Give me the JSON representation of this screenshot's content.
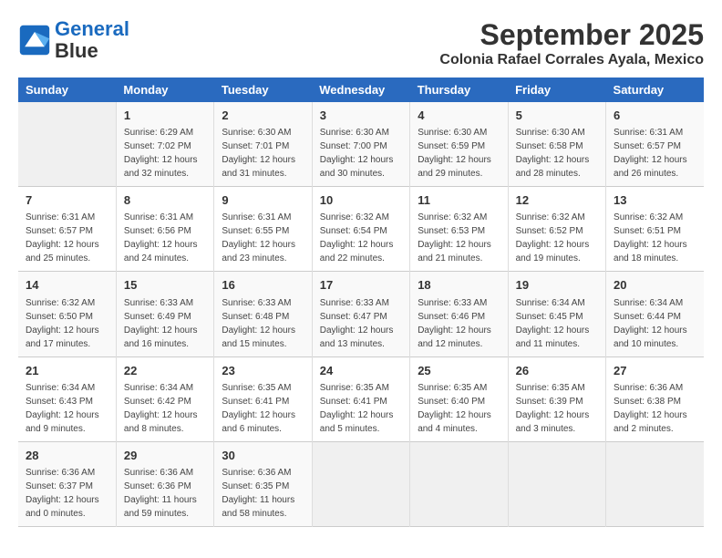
{
  "header": {
    "logo_line1": "General",
    "logo_line2": "Blue",
    "month": "September 2025",
    "location": "Colonia Rafael Corrales Ayala, Mexico"
  },
  "weekdays": [
    "Sunday",
    "Monday",
    "Tuesday",
    "Wednesday",
    "Thursday",
    "Friday",
    "Saturday"
  ],
  "weeks": [
    [
      {
        "day": "",
        "info": ""
      },
      {
        "day": "1",
        "info": "Sunrise: 6:29 AM\nSunset: 7:02 PM\nDaylight: 12 hours\nand 32 minutes."
      },
      {
        "day": "2",
        "info": "Sunrise: 6:30 AM\nSunset: 7:01 PM\nDaylight: 12 hours\nand 31 minutes."
      },
      {
        "day": "3",
        "info": "Sunrise: 6:30 AM\nSunset: 7:00 PM\nDaylight: 12 hours\nand 30 minutes."
      },
      {
        "day": "4",
        "info": "Sunrise: 6:30 AM\nSunset: 6:59 PM\nDaylight: 12 hours\nand 29 minutes."
      },
      {
        "day": "5",
        "info": "Sunrise: 6:30 AM\nSunset: 6:58 PM\nDaylight: 12 hours\nand 28 minutes."
      },
      {
        "day": "6",
        "info": "Sunrise: 6:31 AM\nSunset: 6:57 PM\nDaylight: 12 hours\nand 26 minutes."
      }
    ],
    [
      {
        "day": "7",
        "info": "Sunrise: 6:31 AM\nSunset: 6:57 PM\nDaylight: 12 hours\nand 25 minutes."
      },
      {
        "day": "8",
        "info": "Sunrise: 6:31 AM\nSunset: 6:56 PM\nDaylight: 12 hours\nand 24 minutes."
      },
      {
        "day": "9",
        "info": "Sunrise: 6:31 AM\nSunset: 6:55 PM\nDaylight: 12 hours\nand 23 minutes."
      },
      {
        "day": "10",
        "info": "Sunrise: 6:32 AM\nSunset: 6:54 PM\nDaylight: 12 hours\nand 22 minutes."
      },
      {
        "day": "11",
        "info": "Sunrise: 6:32 AM\nSunset: 6:53 PM\nDaylight: 12 hours\nand 21 minutes."
      },
      {
        "day": "12",
        "info": "Sunrise: 6:32 AM\nSunset: 6:52 PM\nDaylight: 12 hours\nand 19 minutes."
      },
      {
        "day": "13",
        "info": "Sunrise: 6:32 AM\nSunset: 6:51 PM\nDaylight: 12 hours\nand 18 minutes."
      }
    ],
    [
      {
        "day": "14",
        "info": "Sunrise: 6:32 AM\nSunset: 6:50 PM\nDaylight: 12 hours\nand 17 minutes."
      },
      {
        "day": "15",
        "info": "Sunrise: 6:33 AM\nSunset: 6:49 PM\nDaylight: 12 hours\nand 16 minutes."
      },
      {
        "day": "16",
        "info": "Sunrise: 6:33 AM\nSunset: 6:48 PM\nDaylight: 12 hours\nand 15 minutes."
      },
      {
        "day": "17",
        "info": "Sunrise: 6:33 AM\nSunset: 6:47 PM\nDaylight: 12 hours\nand 13 minutes."
      },
      {
        "day": "18",
        "info": "Sunrise: 6:33 AM\nSunset: 6:46 PM\nDaylight: 12 hours\nand 12 minutes."
      },
      {
        "day": "19",
        "info": "Sunrise: 6:34 AM\nSunset: 6:45 PM\nDaylight: 12 hours\nand 11 minutes."
      },
      {
        "day": "20",
        "info": "Sunrise: 6:34 AM\nSunset: 6:44 PM\nDaylight: 12 hours\nand 10 minutes."
      }
    ],
    [
      {
        "day": "21",
        "info": "Sunrise: 6:34 AM\nSunset: 6:43 PM\nDaylight: 12 hours\nand 9 minutes."
      },
      {
        "day": "22",
        "info": "Sunrise: 6:34 AM\nSunset: 6:42 PM\nDaylight: 12 hours\nand 8 minutes."
      },
      {
        "day": "23",
        "info": "Sunrise: 6:35 AM\nSunset: 6:41 PM\nDaylight: 12 hours\nand 6 minutes."
      },
      {
        "day": "24",
        "info": "Sunrise: 6:35 AM\nSunset: 6:41 PM\nDaylight: 12 hours\nand 5 minutes."
      },
      {
        "day": "25",
        "info": "Sunrise: 6:35 AM\nSunset: 6:40 PM\nDaylight: 12 hours\nand 4 minutes."
      },
      {
        "day": "26",
        "info": "Sunrise: 6:35 AM\nSunset: 6:39 PM\nDaylight: 12 hours\nand 3 minutes."
      },
      {
        "day": "27",
        "info": "Sunrise: 6:36 AM\nSunset: 6:38 PM\nDaylight: 12 hours\nand 2 minutes."
      }
    ],
    [
      {
        "day": "28",
        "info": "Sunrise: 6:36 AM\nSunset: 6:37 PM\nDaylight: 12 hours\nand 0 minutes."
      },
      {
        "day": "29",
        "info": "Sunrise: 6:36 AM\nSunset: 6:36 PM\nDaylight: 11 hours\nand 59 minutes."
      },
      {
        "day": "30",
        "info": "Sunrise: 6:36 AM\nSunset: 6:35 PM\nDaylight: 11 hours\nand 58 minutes."
      },
      {
        "day": "",
        "info": ""
      },
      {
        "day": "",
        "info": ""
      },
      {
        "day": "",
        "info": ""
      },
      {
        "day": "",
        "info": ""
      }
    ]
  ]
}
